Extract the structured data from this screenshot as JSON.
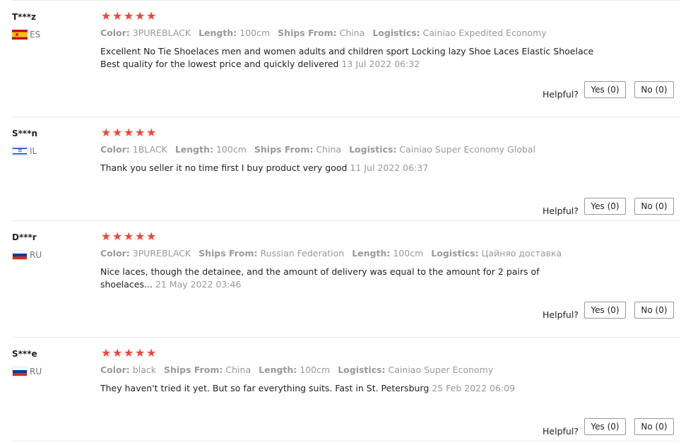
{
  "helpful_label": "Helpful?",
  "star_color": "#f44336",
  "reviews": [
    {
      "user": "T***z",
      "country": "ES",
      "rating": 5,
      "meta": [
        {
          "k": "Color:",
          "v": "3PUREBLACK"
        },
        {
          "k": "Length:",
          "v": "100cm"
        },
        {
          "k": "Ships From:",
          "v": "China"
        },
        {
          "k": "Logistics:",
          "v": "Cainiao Expedited Economy"
        }
      ],
      "text": "Excellent No Tie Shoelaces men and women adults and children sport Locking lazy Shoe Laces Elastic Shoelace Best quality for the lowest price and quickly delivered",
      "date": "13 Jul 2022 06:32",
      "yes_label": "Yes (0)",
      "no_label": "No (0)"
    },
    {
      "user": "S***n",
      "country": "IL",
      "rating": 5,
      "meta": [
        {
          "k": "Color:",
          "v": "1BLACK"
        },
        {
          "k": "Length:",
          "v": "100cm"
        },
        {
          "k": "Ships From:",
          "v": "China"
        },
        {
          "k": "Logistics:",
          "v": "Cainiao Super Economy Global"
        }
      ],
      "text": "Thank you seller it no time first I buy product very good",
      "date": "11 Jul 2022 06:37",
      "yes_label": "Yes (0)",
      "no_label": "No (0)"
    },
    {
      "user": "D***r",
      "country": "RU",
      "rating": 5,
      "meta": [
        {
          "k": "Color:",
          "v": "3PUREBLACK"
        },
        {
          "k": "Ships From:",
          "v": "Russian Federation"
        },
        {
          "k": "Length:",
          "v": "100cm"
        },
        {
          "k": "Logistics:",
          "v": "Цайняо доставка"
        }
      ],
      "text": "Nice laces, though the detainee, and the amount of delivery was equal to the amount for 2 pairs of shoelaces...",
      "date": "21 May 2022 03:46",
      "yes_label": "Yes (0)",
      "no_label": "No (0)"
    },
    {
      "user": "S***e",
      "country": "RU",
      "rating": 5,
      "meta": [
        {
          "k": "Color:",
          "v": "black"
        },
        {
          "k": "Ships From:",
          "v": "China"
        },
        {
          "k": "Length:",
          "v": "100cm"
        },
        {
          "k": "Logistics:",
          "v": "Cainiao Super Economy"
        }
      ],
      "text": "They haven't tried it yet. But so far everything suits. Fast in St. Petersburg",
      "date": "25 Feb 2022 06:09",
      "yes_label": "Yes (0)",
      "no_label": "No (0)"
    }
  ]
}
